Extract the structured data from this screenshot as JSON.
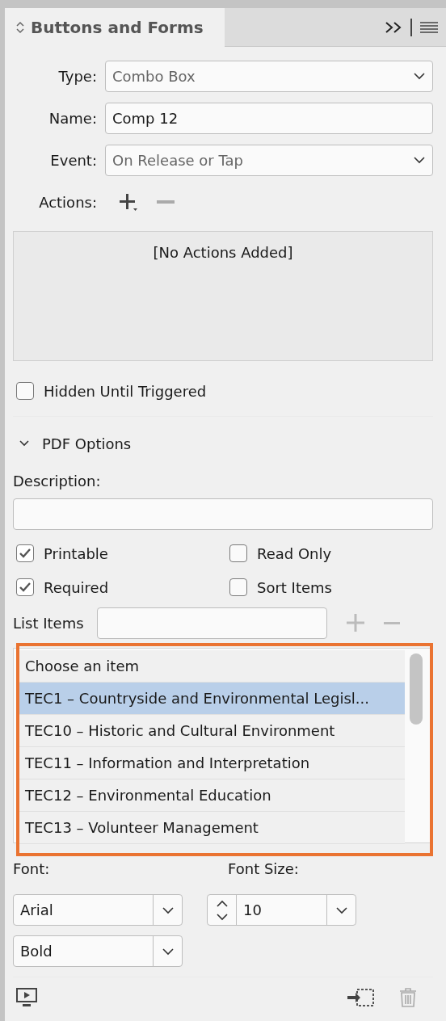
{
  "panel": {
    "title": "Buttons and Forms"
  },
  "fields": [
    {
      "label": "Type:",
      "kind": "select",
      "value": "Combo Box"
    },
    {
      "label": "Name:",
      "kind": "text",
      "value": "Comp 12"
    },
    {
      "label": "Event:",
      "kind": "select",
      "value": "On Release or Tap"
    }
  ],
  "actions": {
    "label": "Actions:",
    "empty_text": "[No Actions Added]"
  },
  "hidden_until_triggered": {
    "label": "Hidden Until Triggered",
    "checked": false
  },
  "pdf_options": {
    "title": "PDF Options",
    "expanded": true,
    "description_label": "Description:",
    "checkboxes": [
      {
        "label": "Printable",
        "checked": true
      },
      {
        "label": "Read Only",
        "checked": false
      },
      {
        "label": "Required",
        "checked": true
      },
      {
        "label": "Sort Items",
        "checked": false
      }
    ],
    "list_items_label": "List Items",
    "list_items": [
      {
        "text": "Choose an item",
        "selected": false
      },
      {
        "text": "TEC1 – Countryside and Environmental Legisl...",
        "selected": true
      },
      {
        "text": "TEC10 – Historic and Cultural Environment",
        "selected": false
      },
      {
        "text": "TEC11 – Information and Interpretation",
        "selected": false
      },
      {
        "text": "TEC12 – Environmental Education",
        "selected": false
      },
      {
        "text": "TEC13 – Volunteer Management",
        "selected": false
      }
    ],
    "font_label": "Font:",
    "font": "Arial",
    "style": "Bold",
    "font_size_label": "Font Size:",
    "font_size": "10"
  }
}
